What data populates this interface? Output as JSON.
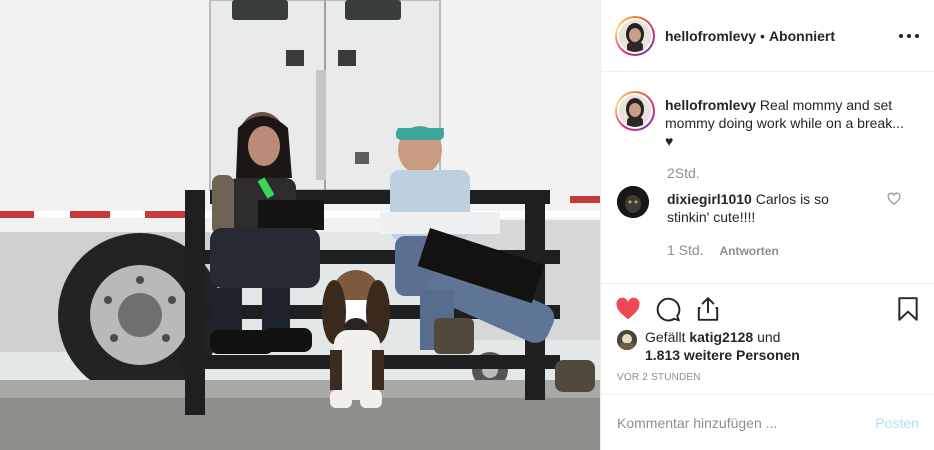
{
  "header": {
    "username": "hellofromlevy",
    "separator": "•",
    "follow_status": "Abonniert"
  },
  "caption": {
    "username": "hellofromlevy",
    "text": "Real mommy and set mommy doing work while on a break... ♥",
    "time": "2Std."
  },
  "comment": {
    "username": "dixiegirl1010",
    "text": "Carlos is so stinkin' cute!!!!",
    "time": "1 Std.",
    "reply_label": "Antworten"
  },
  "actions": {
    "like_icon": "heart-filled-icon",
    "comment_icon": "comment-icon",
    "share_icon": "share-icon",
    "save_icon": "bookmark-icon",
    "liked_color": "#ed4956"
  },
  "likes": {
    "prefix": "Gefällt",
    "liked_by": "katig2128",
    "conjunction": "und",
    "others": "1.813 weitere Personen"
  },
  "timestamp": "vor 2 Stunden",
  "add_comment": {
    "placeholder": "Kommentar hinzufügen ...",
    "post_label": "Posten",
    "post_color": "#b2dffc"
  }
}
